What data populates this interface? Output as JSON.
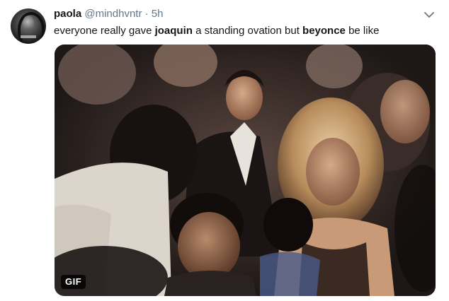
{
  "tweet": {
    "display_name": "paola",
    "handle": "@mindhvntr",
    "separator": "·",
    "time": "5h",
    "text_part1": "everyone really gave ",
    "bold1": "joaquin",
    "text_part2": " a standing ovation but ",
    "bold2": "beyonce",
    "text_part3": " be like",
    "media_badge": "GIF"
  },
  "icons": {
    "avatar": "avatar-image",
    "menu": "chevron-down-icon"
  },
  "colors": {
    "text": "#14171a",
    "secondary": "#657786",
    "background": "#ffffff"
  }
}
